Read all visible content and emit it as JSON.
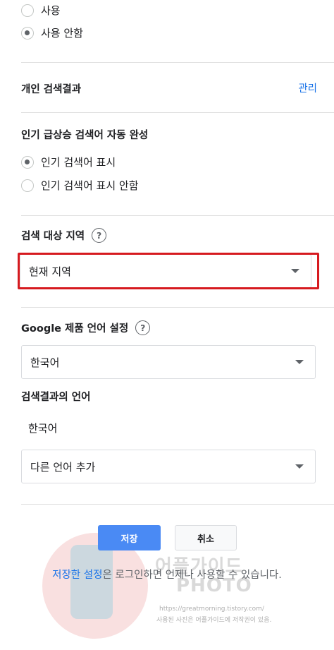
{
  "top_radios": [
    {
      "label": "사용",
      "checked": false
    },
    {
      "label": "사용 안함",
      "checked": true
    }
  ],
  "personal_results": {
    "title": "개인 검색결과",
    "manage_label": "관리"
  },
  "trending": {
    "title": "인기 급상승 검색어 자동 완성",
    "options": [
      {
        "label": "인기 검색어 표시",
        "checked": true
      },
      {
        "label": "인기 검색어 표시 안함",
        "checked": false
      }
    ]
  },
  "region": {
    "title": "검색 대상 지역",
    "help": "?",
    "selected": "현재 지역"
  },
  "product_language": {
    "title": "Google 제품 언어 설정",
    "help": "?",
    "selected": "한국어"
  },
  "result_language": {
    "title": "검색결과의 언어",
    "current": "한국어",
    "add_label": "다른 언어 추가"
  },
  "actions": {
    "save_label": "저장",
    "cancel_label": "취소"
  },
  "note": {
    "link_text": "저장한 설정",
    "rest_text": "은 로그인하면 언제나 사용할 수 있습니다."
  },
  "watermark": {
    "title_line1": "어플가이드",
    "title_line2": "PHOTO",
    "url": "https://greatmorning.tistory.com/",
    "notice": "사용된 사진은 어플가이드에 저작권이 있음."
  },
  "colors": {
    "link": "#1a73e8",
    "primary_button": "#4a8af4",
    "highlight_box": "#d61a1f"
  }
}
